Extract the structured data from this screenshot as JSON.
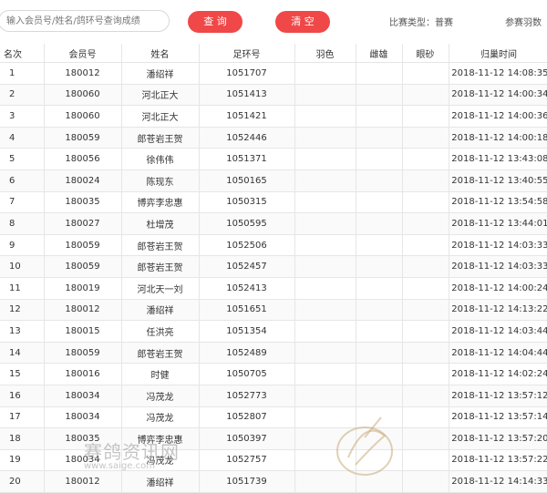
{
  "search": {
    "placeholder": "输入会员号/姓名/鸽环号查询成绩"
  },
  "buttons": {
    "query": "查 询",
    "clear": "清 空"
  },
  "info": {
    "race_type": "比赛类型：普赛",
    "race_count": "参赛羽数"
  },
  "table": {
    "headers": [
      "名次",
      "会员号",
      "姓名",
      "足环号",
      "羽色",
      "雌雄",
      "眼砂",
      "归巢时间"
    ],
    "rows": [
      [
        "1",
        "180012",
        "潘绍祥",
        "1051707",
        "",
        "",
        "",
        "2018-11-12 14:08:35"
      ],
      [
        "2",
        "180060",
        "河北正大",
        "1051413",
        "",
        "",
        "",
        "2018-11-12 14:00:34"
      ],
      [
        "3",
        "180060",
        "河北正大",
        "1051421",
        "",
        "",
        "",
        "2018-11-12 14:00:36"
      ],
      [
        "4",
        "180059",
        "郎苍岩王贺",
        "1052446",
        "",
        "",
        "",
        "2018-11-12 14:00:18"
      ],
      [
        "5",
        "180056",
        "徐伟伟",
        "1051371",
        "",
        "",
        "",
        "2018-11-12 13:43:08"
      ],
      [
        "6",
        "180024",
        "陈现东",
        "1050165",
        "",
        "",
        "",
        "2018-11-12 13:40:55"
      ],
      [
        "7",
        "180035",
        "博弈李忠惠",
        "1050315",
        "",
        "",
        "",
        "2018-11-12 13:54:58"
      ],
      [
        "8",
        "180027",
        "杜增茂",
        "1050595",
        "",
        "",
        "",
        "2018-11-12 13:44:01"
      ],
      [
        "9",
        "180059",
        "郎苍岩王贺",
        "1052506",
        "",
        "",
        "",
        "2018-11-12 14:03:33"
      ],
      [
        "10",
        "180059",
        "郎苍岩王贺",
        "1052457",
        "",
        "",
        "",
        "2018-11-12 14:03:33"
      ],
      [
        "11",
        "180019",
        "河北天一刘",
        "1052413",
        "",
        "",
        "",
        "2018-11-12 14:00:24"
      ],
      [
        "12",
        "180012",
        "潘绍祥",
        "1051651",
        "",
        "",
        "",
        "2018-11-12 14:13:22"
      ],
      [
        "13",
        "180015",
        "任洪亮",
        "1051354",
        "",
        "",
        "",
        "2018-11-12 14:03:44"
      ],
      [
        "14",
        "180059",
        "郎苍岩王贺",
        "1052489",
        "",
        "",
        "",
        "2018-11-12 14:04:44"
      ],
      [
        "15",
        "180016",
        "时健",
        "1050705",
        "",
        "",
        "",
        "2018-11-12 14:02:24"
      ],
      [
        "16",
        "180034",
        "冯茂龙",
        "1052773",
        "",
        "",
        "",
        "2018-11-12 13:57:12"
      ],
      [
        "17",
        "180034",
        "冯茂龙",
        "1052807",
        "",
        "",
        "",
        "2018-11-12 13:57:14"
      ],
      [
        "18",
        "180035",
        "博弈李忠惠",
        "1050397",
        "",
        "",
        "",
        "2018-11-12 13:57:20"
      ],
      [
        "19",
        "180034",
        "冯茂龙",
        "1052757",
        "",
        "",
        "",
        "2018-11-12 13:57:22"
      ],
      [
        "20",
        "180012",
        "潘绍祥",
        "1051739",
        "",
        "",
        "",
        "2018-11-12 14:14:33"
      ]
    ]
  },
  "watermark": {
    "text": "赛鸽资讯网",
    "url": "www.saige.com",
    "icon": "pigeon-logo-icon"
  },
  "colors": {
    "accent": "#f04848",
    "border": "#e6e6e6"
  }
}
